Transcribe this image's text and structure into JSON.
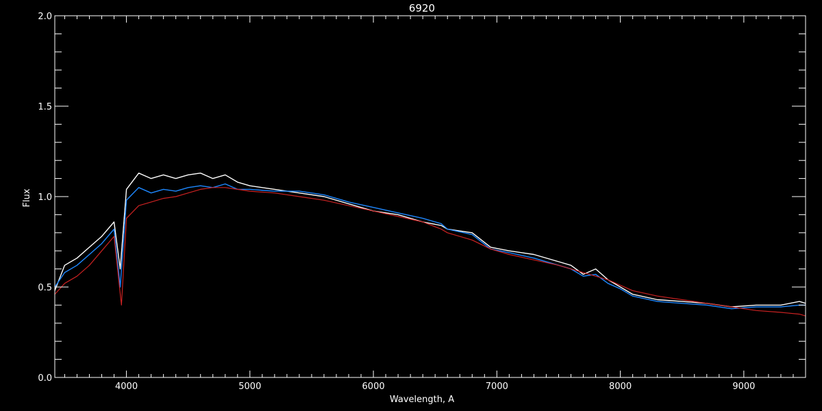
{
  "chart_data": {
    "type": "line",
    "title": "6920",
    "xlabel": "Wavelength, A",
    "ylabel": "Flux",
    "xlim": [
      3420,
      9500
    ],
    "ylim": [
      0.0,
      2.0
    ],
    "x_ticks": [
      {
        "value": 4000,
        "label": "4000"
      },
      {
        "value": 5000,
        "label": "5000"
      },
      {
        "value": 6000,
        "label": "6000"
      },
      {
        "value": 7000,
        "label": "7000"
      },
      {
        "value": 8000,
        "label": "8000"
      },
      {
        "value": 9000,
        "label": "9000"
      }
    ],
    "y_ticks": [
      {
        "value": 0.0,
        "label": "0.0"
      },
      {
        "value": 0.5,
        "label": "0.5"
      },
      {
        "value": 1.0,
        "label": "1.0"
      },
      {
        "value": 1.5,
        "label": "1.5"
      },
      {
        "value": 2.0,
        "label": "2.0"
      }
    ],
    "x_minor_step": 100,
    "y_minor_step": 0.1,
    "colors": {
      "background": "#000000",
      "axes": "#ffffff",
      "text": "#ffffff",
      "observed": "#ffffff",
      "model": "#1e88ff",
      "continuum": "#cc2222"
    },
    "series": [
      {
        "color": "#ffffff",
        "x": [
          3420,
          3500,
          3600,
          3700,
          3800,
          3900,
          3950,
          4000,
          4100,
          4200,
          4300,
          4400,
          4500,
          4600,
          4700,
          4800,
          4900,
          5000,
          5200,
          5400,
          5600,
          5800,
          6000,
          6200,
          6400,
          6550,
          6600,
          6800,
          6950,
          7100,
          7300,
          7500,
          7600,
          7700,
          7800,
          7900,
          8000,
          8100,
          8300,
          8500,
          8700,
          8900,
          9100,
          9300,
          9450,
          9500
        ],
        "y": [
          0.48,
          0.62,
          0.66,
          0.72,
          0.78,
          0.86,
          0.6,
          1.04,
          1.13,
          1.1,
          1.12,
          1.1,
          1.12,
          1.13,
          1.1,
          1.12,
          1.08,
          1.06,
          1.04,
          1.02,
          1.0,
          0.96,
          0.92,
          0.9,
          0.86,
          0.84,
          0.82,
          0.8,
          0.72,
          0.7,
          0.68,
          0.64,
          0.62,
          0.57,
          0.6,
          0.54,
          0.5,
          0.46,
          0.43,
          0.42,
          0.41,
          0.39,
          0.4,
          0.4,
          0.42,
          0.41
        ]
      },
      {
        "color": "#1e88ff",
        "x": [
          3420,
          3500,
          3600,
          3700,
          3800,
          3900,
          3950,
          4000,
          4100,
          4200,
          4300,
          4400,
          4500,
          4600,
          4700,
          4800,
          4900,
          5000,
          5200,
          5400,
          5600,
          5800,
          6000,
          6200,
          6400,
          6550,
          6600,
          6800,
          6950,
          7100,
          7300,
          7500,
          7600,
          7700,
          7800,
          7900,
          8000,
          8100,
          8300,
          8500,
          8700,
          8900,
          9100,
          9300,
          9450,
          9500
        ],
        "y": [
          0.5,
          0.58,
          0.62,
          0.68,
          0.74,
          0.82,
          0.5,
          0.98,
          1.05,
          1.02,
          1.04,
          1.03,
          1.05,
          1.06,
          1.05,
          1.07,
          1.04,
          1.04,
          1.03,
          1.03,
          1.01,
          0.97,
          0.94,
          0.91,
          0.88,
          0.85,
          0.82,
          0.79,
          0.71,
          0.69,
          0.66,
          0.62,
          0.6,
          0.56,
          0.57,
          0.52,
          0.49,
          0.45,
          0.42,
          0.41,
          0.4,
          0.38,
          0.39,
          0.39,
          0.4,
          0.4
        ]
      },
      {
        "color": "#cc2222",
        "x": [
          3420,
          3500,
          3600,
          3700,
          3800,
          3900,
          3960,
          4000,
          4100,
          4200,
          4300,
          4400,
          4500,
          4600,
          4700,
          4800,
          4900,
          5000,
          5200,
          5400,
          5600,
          5800,
          6000,
          6200,
          6400,
          6550,
          6600,
          6800,
          6950,
          7100,
          7300,
          7500,
          7600,
          7700,
          7800,
          7900,
          8000,
          8100,
          8300,
          8500,
          8700,
          8900,
          9100,
          9300,
          9450,
          9500
        ],
        "y": [
          0.46,
          0.52,
          0.56,
          0.62,
          0.7,
          0.78,
          0.4,
          0.88,
          0.95,
          0.97,
          0.99,
          1.0,
          1.02,
          1.04,
          1.05,
          1.05,
          1.04,
          1.03,
          1.02,
          1.0,
          0.98,
          0.95,
          0.92,
          0.89,
          0.86,
          0.82,
          0.8,
          0.76,
          0.71,
          0.68,
          0.65,
          0.62,
          0.6,
          0.58,
          0.56,
          0.54,
          0.51,
          0.48,
          0.45,
          0.43,
          0.41,
          0.39,
          0.37,
          0.36,
          0.35,
          0.34
        ]
      }
    ]
  }
}
